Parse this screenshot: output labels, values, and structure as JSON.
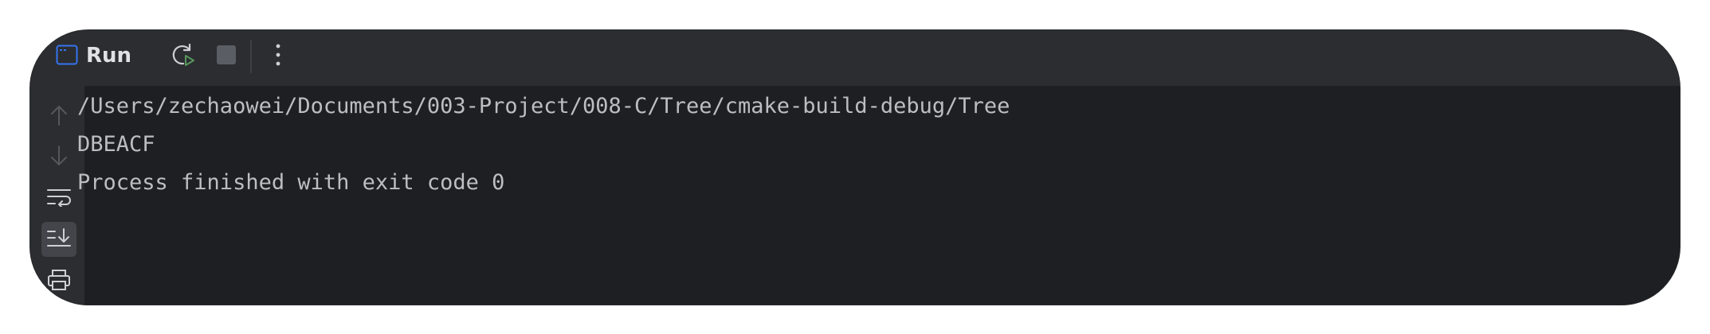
{
  "toolbar": {
    "title": "Run",
    "icons": {
      "run_window": "run-window-icon",
      "rerun": "rerun-icon",
      "stop": "stop-icon",
      "more": "more-vertical-icon"
    }
  },
  "gutter": {
    "icons": [
      "arrow-up-icon",
      "arrow-down-icon",
      "soft-wrap-icon",
      "scroll-to-end-icon",
      "print-icon"
    ],
    "active": "scroll-to-end-icon"
  },
  "console": {
    "lines": [
      "/Users/zechaowei/Documents/003-Project/008-C/Tree/cmake-build-debug/Tree",
      "DBEACF",
      "Process finished with exit code 0"
    ]
  },
  "colors": {
    "toolbar_bg": "#2b2d30",
    "console_bg": "#1e1f22",
    "text": "#bcbec4",
    "rerun_accent": "#57965c",
    "run_icon_accent": "#3574f0"
  }
}
